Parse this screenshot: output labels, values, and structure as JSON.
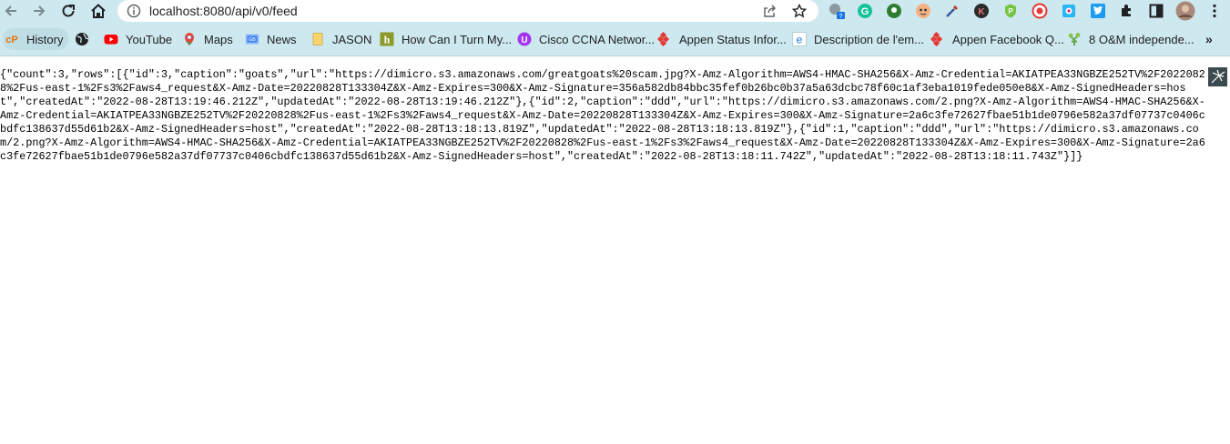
{
  "browser": {
    "url": "localhost:8080/api/v0/feed",
    "icons": [
      "back-icon",
      "forward-icon",
      "reload-icon",
      "home-icon",
      "site-info-icon",
      "share-icon",
      "bookmark-star-icon"
    ],
    "extensions": [
      "extension-1-icon",
      "grammarly-icon",
      "extension-3-icon",
      "extension-4-icon",
      "eyedropper-icon",
      "k-extension-icon",
      "shield-extension-icon",
      "record-extension-icon",
      "extension-9-icon",
      "twitter-icon",
      "puzzle-icon",
      "sidepanel-icon",
      "profile-avatar",
      "menu-dots-icon"
    ]
  },
  "bookmarks": [
    {
      "label": "History",
      "icon": "history-icon",
      "color": "#e8710a"
    },
    {
      "label": "",
      "icon": "globe-icon",
      "color": "#202124"
    },
    {
      "label": "YouTube",
      "icon": "youtube-icon",
      "color": "#ff0000"
    },
    {
      "label": "Maps",
      "icon": "maps-icon",
      "color": "#34a853"
    },
    {
      "label": "News",
      "icon": "news-icon",
      "color": "#4285f4"
    },
    {
      "label": "JASON",
      "icon": "folder-icon",
      "color": "#f9d56b"
    },
    {
      "label": "How Can I Turn My...",
      "icon": "h-site-icon",
      "color": "#7c8a2a"
    },
    {
      "label": "Cisco CCNA Networ...",
      "icon": "udemy-icon",
      "color": "#a435f0"
    },
    {
      "label": "Appen Status Infor...",
      "icon": "appen-icon",
      "color": "#e53935"
    },
    {
      "label": "Description de l'em...",
      "icon": "e-site-icon",
      "color": "#1a73e8"
    },
    {
      "label": "Appen Facebook Q...",
      "icon": "appen-icon",
      "color": "#e53935"
    },
    {
      "label": "8 O&M independe...",
      "icon": "tree-icon",
      "color": "#6aa84f"
    }
  ],
  "content": {
    "json_text": "{\"count\":3,\"rows\":[{\"id\":3,\"caption\":\"goats\",\"url\":\"https://dimicro.s3.amazonaws.com/greatgoats%20scam.jpg?X-Amz-Algorithm=AWS4-HMAC-SHA256&X-Amz-Credential=AKIATPEA33NGBZE252TV%2F20220828%2Fus-east-1%2Fs3%2Faws4_request&X-Amz-Date=20220828T133304Z&X-Amz-Expires=300&X-Amz-Signature=356a582db84bbc35fef0b26bc0b37a5a63dcbc78f60c1af3eba1019fede050e8&X-Amz-SignedHeaders=host\",\"createdAt\":\"2022-08-28T13:19:46.212Z\",\"updatedAt\":\"2022-08-28T13:19:46.212Z\"},{\"id\":2,\"caption\":\"ddd\",\"url\":\"https://dimicro.s3.amazonaws.com/2.png?X-Amz-Algorithm=AWS4-HMAC-SHA256&X-Amz-Credential=AKIATPEA33NGBZE252TV%2F20220828%2Fus-east-1%2Fs3%2Faws4_request&X-Amz-Date=20220828T133304Z&X-Amz-Expires=300&X-Amz-Signature=2a6c3fe72627fbae51b1de0796e582a37df07737c0406cbdfc138637d55d61b2&X-Amz-SignedHeaders=host\",\"createdAt\":\"2022-08-28T13:18:13.819Z\",\"updatedAt\":\"2022-08-28T13:18:13.819Z\"},{\"id\":1,\"caption\":\"ddd\",\"url\":\"https://dimicro.s3.amazonaws.com/2.png?X-Amz-Algorithm=AWS4-HMAC-SHA256&X-Amz-Credential=AKIATPEA33NGBZE252TV%2F20220828%2Fus-east-1%2Fs3%2Faws4_request&X-Amz-Date=20220828T133304Z&X-Amz-Expires=300&X-Amz-Signature=2a6c3fe72627fbae51b1de0796e582a37df07737c0406cbdfc138637d55d61b2&X-Amz-SignedHeaders=host\",\"createdAt\":\"2022-08-28T13:18:11.742Z\",\"updatedAt\":\"2022-08-28T13:18:11.743Z\"}]}"
  }
}
